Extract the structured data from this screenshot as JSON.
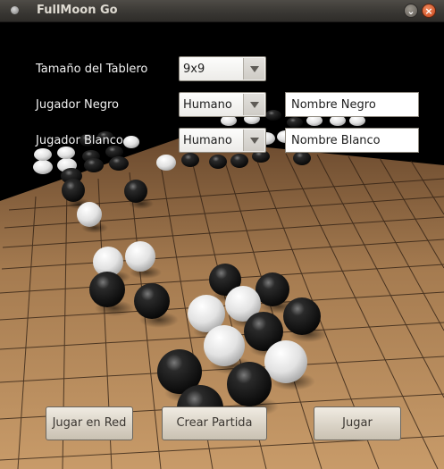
{
  "window": {
    "title": "FullMoon Go"
  },
  "form": {
    "board_size": {
      "label": "Tamaño del Tablero",
      "value": "9x9"
    },
    "black_player": {
      "label": "Jugador Negro",
      "type": "Humano",
      "name_value": "Nombre Negro"
    },
    "white_player": {
      "label": "Jugador Blanco",
      "type": "Humano",
      "name_value": "Nombre Blanco"
    }
  },
  "buttons": {
    "network": "Jugar en Red",
    "create": "Crear Partida",
    "play": "Jugar"
  }
}
